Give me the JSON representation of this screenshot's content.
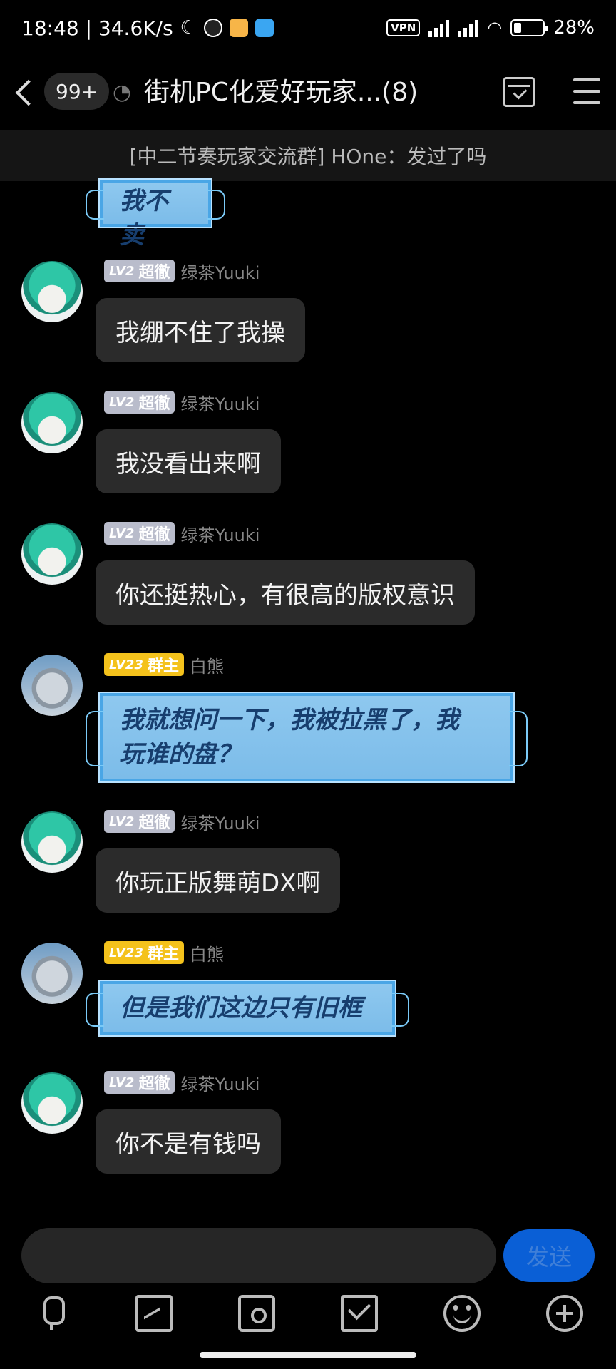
{
  "status_bar": {
    "time_speed": "18:48 | 34.6K/s",
    "vpn": "VPN",
    "battery": "28%"
  },
  "header": {
    "unread_count": "99+",
    "title": "街机PC化爱好玩家...(8)"
  },
  "notice": "[中二节奏玩家交流群] HOne：发过了吗",
  "messages": [
    {
      "type": "mask",
      "text": "我不卖"
    },
    {
      "type": "text",
      "level": "LV2",
      "role": "超徹",
      "name": "绿茶Yuuki",
      "text": "我绷不住了我操"
    },
    {
      "type": "text",
      "level": "LV2",
      "role": "超徹",
      "name": "绿茶Yuuki",
      "text": "我没看出来啊"
    },
    {
      "type": "text",
      "level": "LV2",
      "role": "超徹",
      "name": "绿茶Yuuki",
      "text": "你还挺热心，有很高的版权意识"
    },
    {
      "type": "mask",
      "level": "LV23",
      "role": "群主",
      "name": "白熊",
      "line1": "我就想问一下，我被拉黑了，我",
      "line2": "玩谁的盘？"
    },
    {
      "type": "text",
      "level": "LV2",
      "role": "超徹",
      "name": "绿茶Yuuki",
      "text": "你玩正版舞萌DX啊"
    },
    {
      "type": "mask",
      "level": "LV23",
      "role": "群主",
      "name": "白熊",
      "text": "但是我们这边只有旧框"
    },
    {
      "type": "text",
      "level": "LV2",
      "role": "超徹",
      "name": "绿茶Yuuki",
      "text": "你不是有钱吗"
    }
  ],
  "composer": {
    "send_label": "发送"
  },
  "toolbar_icons": [
    "mic-icon",
    "image-icon",
    "camera-icon",
    "red-packet-icon",
    "emoji-icon",
    "plus-icon"
  ]
}
